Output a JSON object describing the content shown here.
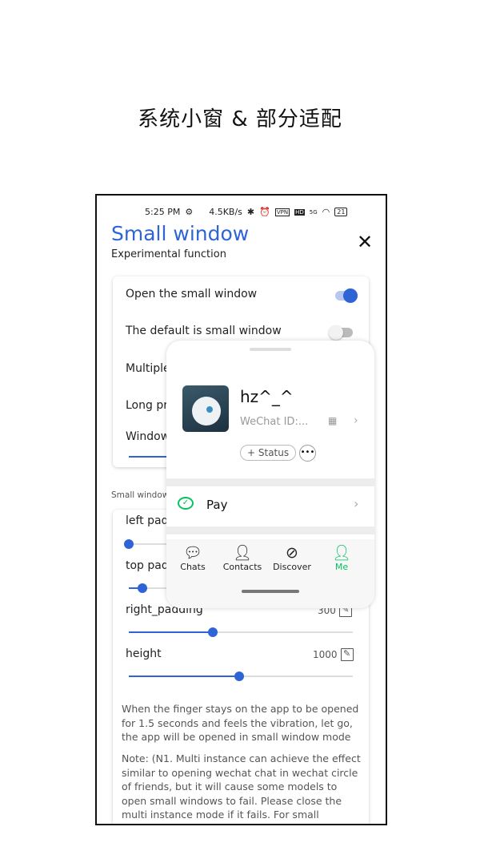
{
  "caption": "系统小窗 & 部分适配",
  "status_bar": {
    "time": "5:25 PM",
    "speed": "4.5KB/s",
    "vpn": "VPN",
    "hd": "HD",
    "network": "5G",
    "battery": "21"
  },
  "header": {
    "title": "Small window",
    "subtitle": "Experimental function"
  },
  "settings": [
    {
      "label": "Open the small window",
      "on": true
    },
    {
      "label": "The default is small window",
      "on": false
    },
    {
      "label": "Multiple"
    },
    {
      "label": "Long pr"
    },
    {
      "label": "Window"
    }
  ],
  "section_label": "Small window",
  "sliders": [
    {
      "label": "left pad",
      "value": null,
      "fraction": 0.0
    },
    {
      "label": "top pad",
      "value": null,
      "fraction": 0.06
    },
    {
      "label": "right_padding",
      "value": "300",
      "fraction": 0.375
    },
    {
      "label": "height",
      "value": "1000",
      "fraction": 0.495
    }
  ],
  "description": "When the finger stays on the app to be opened for 1.5 seconds and feels the vibration, let go, the app will be opened in small window mode",
  "note": "Note: (N1. Multi instance can achieve the effect similar to opening wechat chat in wechat circle of friends, but it will cause some models to open small windows to fail. Please close the multi instance mode if it fails. For small",
  "wechat": {
    "name": "hz^_^",
    "wechat_id": "WeChat ID:...",
    "status_button": "+ Status",
    "pay": "Pay",
    "tabs": [
      {
        "label": "Chats",
        "icon": "chat-bubble-icon"
      },
      {
        "label": "Contacts",
        "icon": "contacts-icon"
      },
      {
        "label": "Discover",
        "icon": "compass-icon"
      },
      {
        "label": "Me",
        "icon": "person-icon",
        "active": true
      }
    ],
    "accent": "#07c160"
  },
  "colors": {
    "accent": "#2f64d6"
  }
}
